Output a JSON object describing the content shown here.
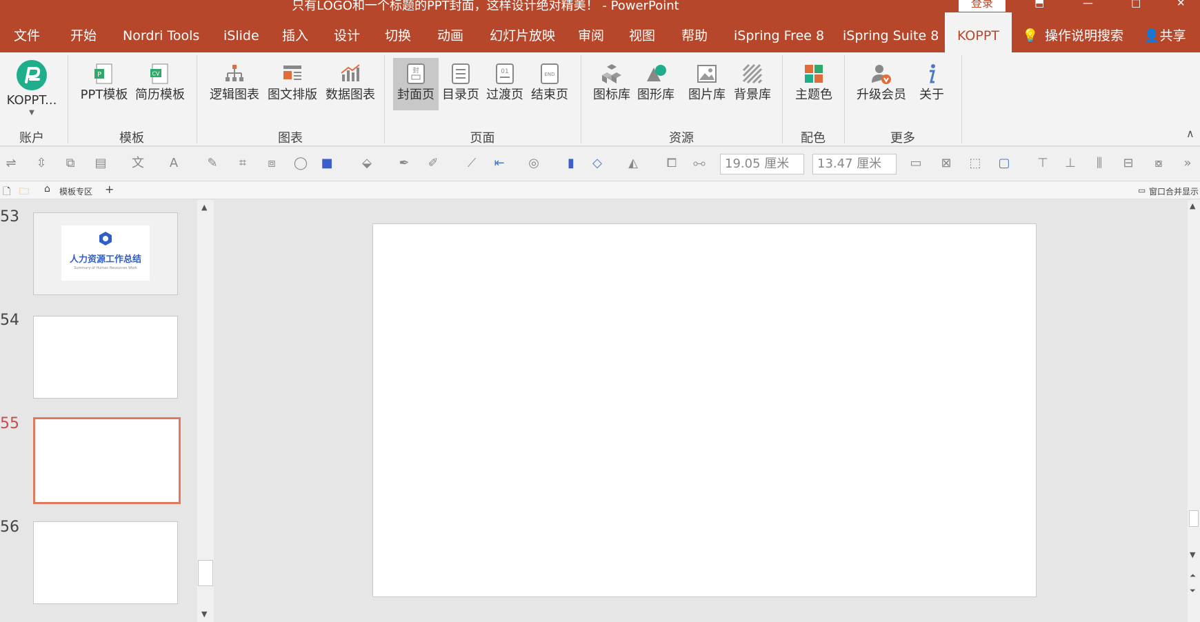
{
  "window": {
    "title": "只有LOGO和一个标题的PPT封面，这样设计绝对精美！ - PowerPoint",
    "login_label": "登录"
  },
  "tabs": [
    "文件",
    "开始",
    "Nordri Tools",
    "iSlide",
    "插入",
    "设计",
    "切换",
    "动画",
    "幻灯片放映",
    "审阅",
    "视图",
    "帮助",
    "iSpring Free 8",
    "iSpring Suite 8",
    "KOPPT"
  ],
  "active_tab": "KOPPT",
  "search_label": "操作说明搜索",
  "share_label": "共享",
  "ribbon": {
    "account": {
      "button": "KOPPT...",
      "group": "账户"
    },
    "template": {
      "buttons": [
        "PPT模板",
        "简历模板"
      ],
      "group": "模板"
    },
    "chart": {
      "buttons": [
        "逻辑图表",
        "图文排版",
        "数据图表"
      ],
      "group": "图表"
    },
    "page": {
      "buttons": [
        "封面页",
        "目录页",
        "过渡页",
        "结束页"
      ],
      "group": "页面"
    },
    "resource": {
      "buttons": [
        "图标库",
        "图形库",
        "图片库",
        "背景库"
      ],
      "group": "资源"
    },
    "color": {
      "buttons": [
        "主题色"
      ],
      "group": "配色"
    },
    "more": {
      "buttons": [
        "升级会员",
        "关于"
      ],
      "group": "更多"
    },
    "cover_badge": "封",
    "transition_badge": "01",
    "end_badge": "END",
    "cv_badge": "CV"
  },
  "size": {
    "width": "19.05 厘米",
    "height": "13.47 厘米"
  },
  "docbar": {
    "home_label": "模板专区",
    "merge_label": "窗口合并显示"
  },
  "slides": [
    {
      "num": "53",
      "title": "人力资源工作总结",
      "subtitle": "Summary of Human Resources Work"
    },
    {
      "num": "54"
    },
    {
      "num": "55"
    },
    {
      "num": "56"
    }
  ],
  "colors": {
    "accent": "#b7472a",
    "selected_slide": "#e07a5f"
  }
}
